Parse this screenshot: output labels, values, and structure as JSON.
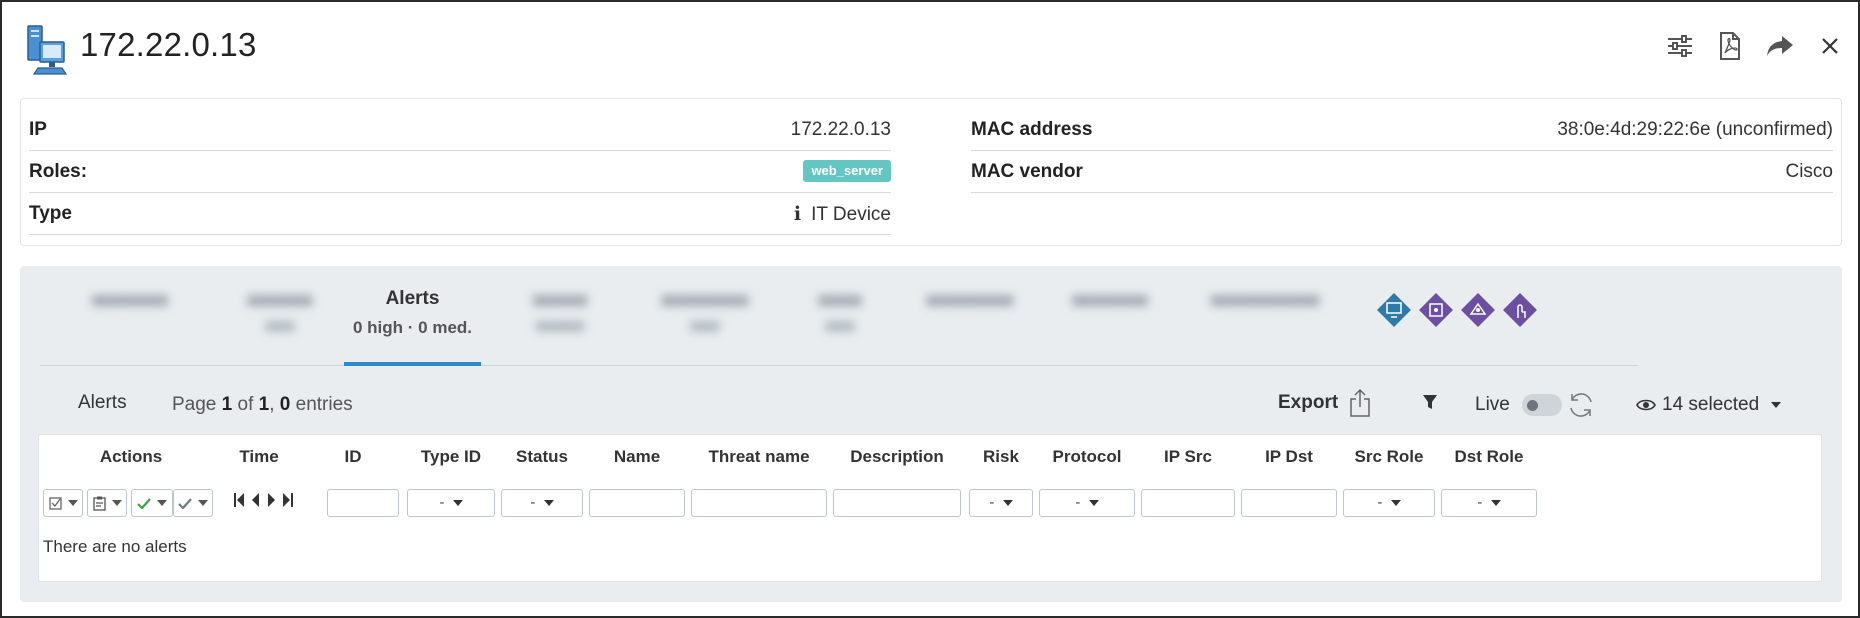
{
  "header": {
    "title": "172.22.0.13",
    "icons": [
      "settings-sliders-icon",
      "pdf-icon",
      "share-icon",
      "close-icon"
    ]
  },
  "info": {
    "ip_label": "IP",
    "ip_value": "172.22.0.13",
    "roles_label": "Roles:",
    "roles_badge": "web_server",
    "type_label": "Type",
    "type_info_icon": "i",
    "type_value": "IT Device",
    "mac_label": "MAC address",
    "mac_value": "38:0e:4d:29:22:6e (unconfirmed)",
    "vendor_label": "MAC vendor",
    "vendor_value": "Cisco"
  },
  "tabs": {
    "active_title": "Alerts",
    "active_subtitle": "0 high · 0 med."
  },
  "toolbar": {
    "title": "Alerts",
    "page_prefix": "Page ",
    "page_num": "1",
    "page_of": " of ",
    "page_total": "1",
    "page_sep": ", ",
    "entries_num": "0",
    "entries_label": " entries",
    "export_label": "Export",
    "live_label": "Live",
    "columns_selected": "14 selected"
  },
  "table": {
    "columns": [
      "Actions",
      "Time",
      "ID",
      "Type ID",
      "Status",
      "Name",
      "Threat name",
      "Description",
      "Risk",
      "Protocol",
      "IP Src",
      "IP Dst",
      "Src Role",
      "Dst Role"
    ],
    "select_placeholder": "-",
    "empty_message": "There are no alerts"
  },
  "colors": {
    "accent": "#2f86c8",
    "badge": "#63c6c3",
    "diamond_blue": "#2f7ba8",
    "diamond_purple": "#6c4f9e",
    "panel_bg": "#e9edf0"
  }
}
